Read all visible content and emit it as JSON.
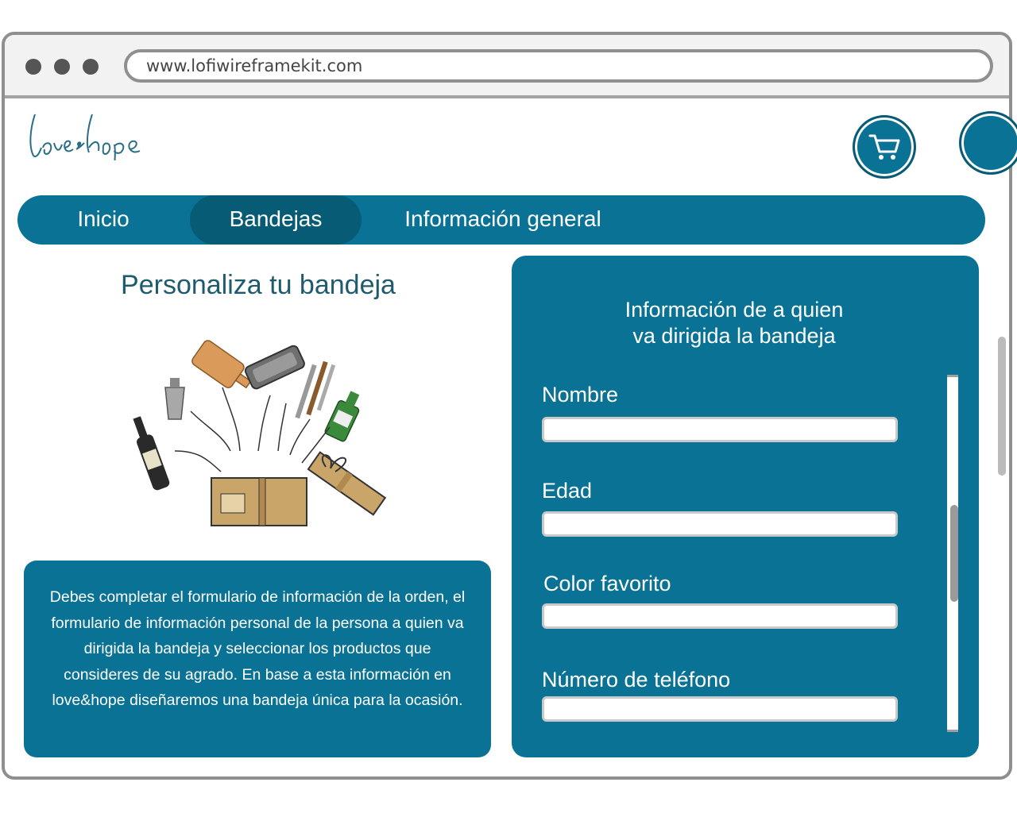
{
  "browser": {
    "url": "www.lofiwireframekit.com"
  },
  "header": {
    "logo_text": "love♥hope",
    "cart_icon": "cart-icon",
    "profile_icon": "user-circle-icon"
  },
  "nav": {
    "items": [
      {
        "label": "Inicio",
        "active": false
      },
      {
        "label": "Bandejas",
        "active": true
      },
      {
        "label": "Información general",
        "active": false
      }
    ]
  },
  "main": {
    "title": "Personaliza tu bandeja",
    "illustration_icon": "gift-tray-illustration",
    "description": "Debes completar el formulario de información de la orden, el formulario de información personal de la persona a quien va dirigida la bandeja y seleccionar los productos que consideres de su agrado. En base a esta información en love&hope diseñaremos una bandeja única para la ocasión."
  },
  "form": {
    "heading_line1": "Información de a quien",
    "heading_line2": "va dirigida la bandeja",
    "fields": [
      {
        "label": "Nombre",
        "value": ""
      },
      {
        "label": "Edad",
        "value": ""
      },
      {
        "label": "Color favorito",
        "value": ""
      },
      {
        "label": "Número de teléfono",
        "value": ""
      }
    ]
  },
  "colors": {
    "primary": "#0a7294",
    "primary_dark": "#085b75",
    "title_text": "#1f5b6e"
  }
}
